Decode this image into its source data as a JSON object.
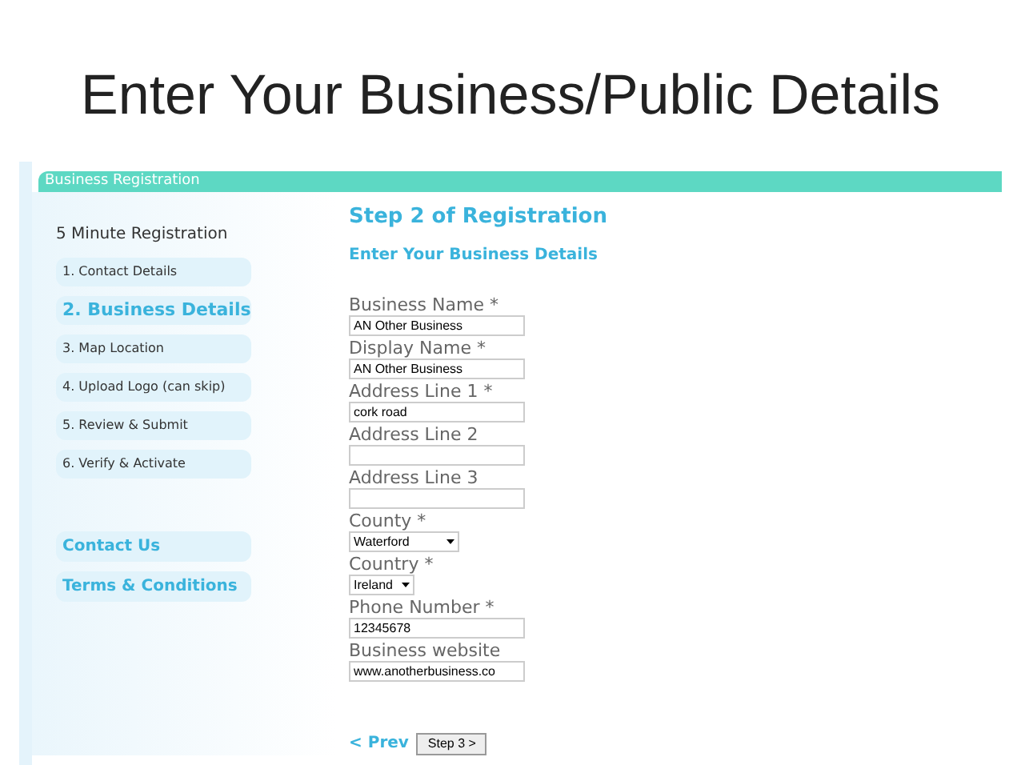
{
  "slide_title": "Enter Your Business/Public Details",
  "window": {
    "title": "Business Registration"
  },
  "sidebar": {
    "heading": "5 Minute Registration",
    "steps": [
      {
        "label": "1. Contact Details",
        "selected": false
      },
      {
        "label": "2. Business Details",
        "selected": true
      },
      {
        "label": "3. Map Location",
        "selected": false
      },
      {
        "label": "4. Upload Logo (can skip)",
        "selected": false
      },
      {
        "label": "5. Review & Submit",
        "selected": false
      },
      {
        "label": "6. Verify & Activate",
        "selected": false
      }
    ],
    "links": [
      "Contact Us",
      "Terms & Conditions"
    ]
  },
  "form": {
    "title": "Step 2 of Registration",
    "subtitle": "Enter Your Business Details",
    "fields": [
      {
        "kind": "text",
        "label": "Business Name *",
        "value": "AN Other Business"
      },
      {
        "kind": "text",
        "label": "Display Name *",
        "value": "AN Other Business"
      },
      {
        "kind": "text",
        "label": "Address Line 1 *",
        "value": "cork road"
      },
      {
        "kind": "text",
        "label": "Address Line 2"
      },
      {
        "kind": "text",
        "label": "Address Line 3"
      },
      {
        "kind": "select",
        "label": "County *",
        "value": "Waterford"
      },
      {
        "kind": "select",
        "label": "Country *",
        "value": "Ireland"
      },
      {
        "kind": "text",
        "label": "Phone Number *",
        "value": "12345678"
      },
      {
        "kind": "text",
        "label": "Business website",
        "value": "www.anotherbusiness.co"
      }
    ],
    "prev": "< Prev",
    "next": "Step 3 >"
  }
}
